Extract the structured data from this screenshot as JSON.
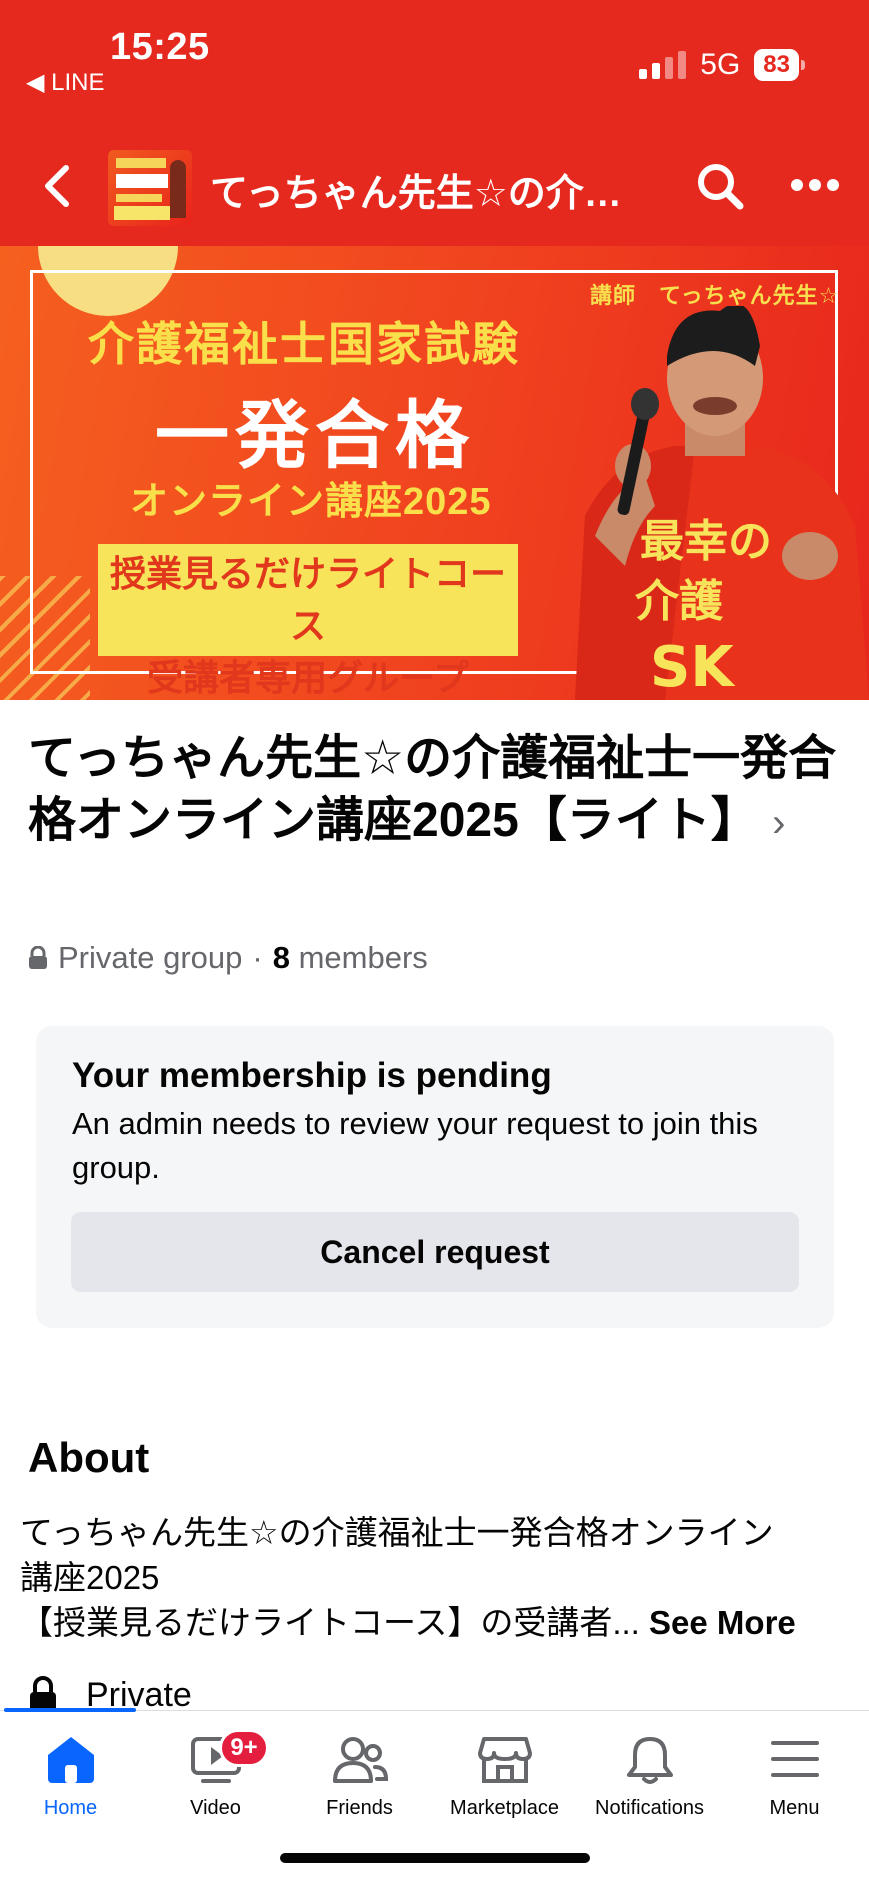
{
  "status_bar": {
    "time": "15:25",
    "back_app": "◀ LINE",
    "network": "5G",
    "battery": "83"
  },
  "header": {
    "title": "てっちゃん先生☆の介護福祉士一発合格オンライン講座2025【ライト】",
    "icons": [
      "back-arrow-icon",
      "search-icon",
      "more-icon"
    ]
  },
  "banner": {
    "lecturer": "講師　てっちゃん先生☆",
    "line1": "介護福祉士国家試験",
    "line2": "一発合格",
    "line3": "オンライン講座2025",
    "box_line1": "授業見るだけライトコース",
    "box_line2": "受講者専用グループ",
    "shirt_text": "最幸の介護 SK",
    "colors": {
      "bg": "#f0411f",
      "accent": "#f9e04b"
    }
  },
  "group": {
    "title": "てっちゃん先生☆の介護福祉士一発合格オンライン講座2025【ライト】",
    "privacy": "Private group",
    "separator": "·",
    "member_count": "8",
    "members_label": "members"
  },
  "pending": {
    "title": "Your membership is pending",
    "description": "An admin needs to review your request to join this group.",
    "cancel_label": "Cancel request"
  },
  "about": {
    "heading": "About",
    "line1": "てっちゃん先生☆の介護福祉士一発合格オンライン",
    "line2": "講座2025",
    "line3": "【授業見るだけライトコース】の受講者...",
    "see_more": "See More",
    "private_label": "Private"
  },
  "bottom_nav": {
    "tabs": [
      {
        "label": "Home",
        "icon": "home-icon",
        "active": true
      },
      {
        "label": "Video",
        "icon": "video-icon",
        "badge": "9+"
      },
      {
        "label": "Friends",
        "icon": "friends-icon"
      },
      {
        "label": "Marketplace",
        "icon": "marketplace-icon"
      },
      {
        "label": "Notifications",
        "icon": "bell-icon"
      },
      {
        "label": "Menu",
        "icon": "menu-icon"
      }
    ],
    "accent": "#0866ff"
  }
}
